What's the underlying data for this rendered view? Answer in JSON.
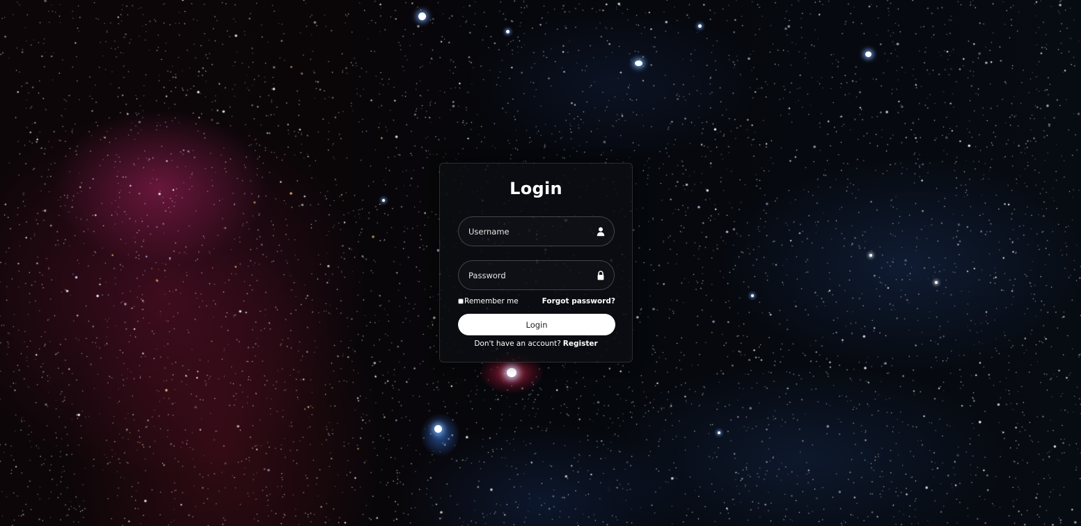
{
  "login_form": {
    "title": "Login",
    "username": {
      "placeholder": "Username",
      "value": "",
      "icon": "user-icon"
    },
    "password": {
      "placeholder": "Password",
      "value": "",
      "icon": "lock-icon"
    },
    "remember_label": "Remember me",
    "remember_checked": false,
    "forgot_label": "Forgot password?",
    "submit_label": "Login",
    "register_prompt": "Don't have an account?",
    "register_label": "Register"
  },
  "colors": {
    "card_background": "#0c0e12",
    "text": "#ffffff",
    "button_background": "#ffffff",
    "button_text": "#222222",
    "nebula_red": "#be286e",
    "nebula_blue": "#2850a0"
  },
  "background": "starfield-nebula"
}
